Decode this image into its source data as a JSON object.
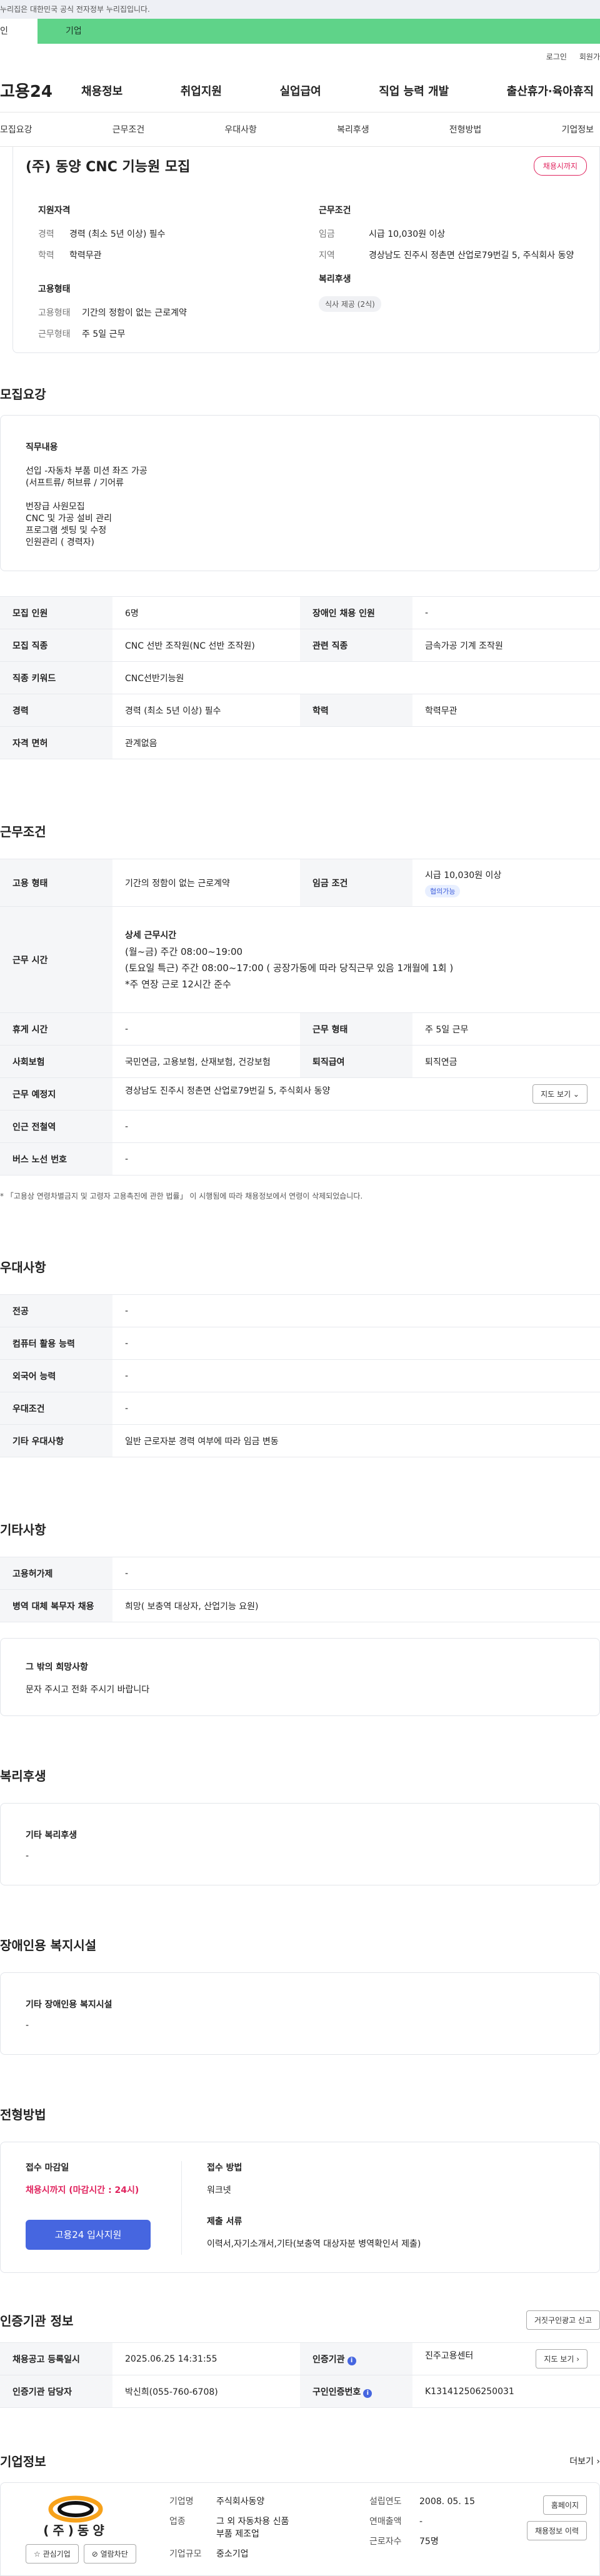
{
  "gov_banner": "누리집은 대한민국 공식 전자정부 누리집입니다.",
  "portal_tabs": {
    "personal": "인",
    "company": "기업"
  },
  "util_links": [
    "로그인",
    "회원가"
  ],
  "gnb": {
    "logo": "고용24",
    "menu": [
      "채용정보",
      "취업지원",
      "실업급여",
      "직업 능력 개발",
      "출산휴가·육아휴직"
    ]
  },
  "subnav": [
    "모집요강",
    "근무조건",
    "우대사항",
    "복리후생",
    "전형방법",
    "기업정보"
  ],
  "summary": {
    "title": "(주) 동양 CNC 기능원 모집",
    "badge": "채용시까지",
    "qualification": {
      "heading": "지원자격",
      "career_k": "경력",
      "career_v": "경력 (최소 5년 이상) 필수",
      "edu_k": "학력",
      "edu_v": "학력무관"
    },
    "conditions": {
      "heading": "근무조건",
      "wage_k": "임금",
      "wage_v": "시급 10,030원 이상",
      "region_k": "지역",
      "region_v": "경상남도 진주시 정촌면 산업로79번길 5, 주식회사 동양"
    },
    "employment": {
      "heading": "고용형태",
      "type_k": "고용형태",
      "type_v": "기간의 정함이 없는 근로계약",
      "form_k": "근무형태",
      "form_v": "주 5일 근무"
    },
    "welfare": {
      "heading": "복리후생",
      "pill": "식사 제공 (2식)"
    }
  },
  "recruit": {
    "section_title": "모집요강",
    "duty_heading": "직무내용",
    "duty_lines": [
      "선입 -자동차 부품 미션 좌즈 가공",
      "(서프트류/ 허브류 / 기어류",
      "",
      "번장급 사원모집",
      "CNC 및 가공 설비 관리",
      "프로그램 셋팅 및 수정",
      "인원관리 ( 경력자)"
    ],
    "rows": [
      [
        "모집 인원",
        "6명",
        "장애인 채용 인원",
        "-"
      ],
      [
        "모집 직종",
        "CNC 선반 조작원(NC 선반 조작원)",
        "관련 직종",
        "금속가공 기계 조작원"
      ],
      [
        "직종 키워드",
        "CNC선반기능원",
        "",
        ""
      ],
      [
        "경력",
        "경력 (최소 5년 이상) 필수",
        "학력",
        "학력무관"
      ],
      [
        "자격 면허",
        "관계없음",
        "",
        ""
      ]
    ]
  },
  "work": {
    "section_title": "근무조건",
    "emp_type_k": "고용 형태",
    "emp_type_v": "기간의 정함이 없는 근로계약",
    "wage_k": "임금 조건",
    "wage_v": "시급 10,030원 이상",
    "wage_pill": "협의가능",
    "hours_k": "근무 시간",
    "hours_heading": "상세 근무시간",
    "hours_lines": [
      "(월~금) 주간 08:00~19:00",
      "(토요일 특근) 주간 08:00~17:00 ( 공장가동에 따라 당직근무 있음 1개월에 1회 )",
      "*주 연장 근로 12시간 준수"
    ],
    "rest_k": "휴게 시간",
    "rest_v": "-",
    "form_k": "근무 형태",
    "form_v": "주 5일 근무",
    "ins_k": "사회보험",
    "ins_v": "국민연금, 고용보험, 산재보험, 건강보험",
    "ret_k": "퇴직급여",
    "ret_v": "퇴직연금",
    "place_k": "근무 예정지",
    "place_v": "경상남도 진주시 정촌면 산업로79번길 5, 주식회사 동양",
    "map_btn": "지도 보기 ⌄",
    "sub_k": "인근 전철역",
    "sub_v": "-",
    "bus_k": "버스 노선 번호",
    "bus_v": "-",
    "note": "* 「고용상 연령차별금지 및 고령자 고용촉진에 관한 법률」 이 시행됨에 따라 채용정보에서 연령이 삭제되었습니다."
  },
  "pref": {
    "section_title": "우대사항",
    "rows": [
      [
        "전공",
        "-"
      ],
      [
        "컴퓨터 활용 능력",
        "-"
      ],
      [
        "외국어 능력",
        "-"
      ],
      [
        "우대조건",
        "-"
      ],
      [
        "기타 우대사항",
        "일반 근로자분 경력 여부에 따라 임금 변동"
      ]
    ]
  },
  "etc": {
    "section_title": "기타사항",
    "rows": [
      [
        "고용허가제",
        "-"
      ],
      [
        "병역 대체 복무자 채용",
        "희망( 보충역 대상자, 산업기능 요원)"
      ]
    ],
    "wish_heading": "그 밖의 희망사항",
    "wish_text": "문자 주시고 전화 주시기 바랍니다"
  },
  "welfare": {
    "section_title": "복리후생",
    "heading": "기타 복리후생",
    "value": "-"
  },
  "disability": {
    "section_title": "장애인용 복지시설",
    "heading": "기타 장애인용 복지시설",
    "value": "-"
  },
  "process": {
    "section_title": "전형방법",
    "deadline_k": "접수 마감일",
    "deadline_v": "채용시까지 (마감시간 : 24시)",
    "apply_btn": "고용24 입사지원",
    "method_k": "접수 방법",
    "method_v": "워크넷",
    "docs_k": "제출 서류",
    "docs_v": "이력서,자기소개서,기타(보충역 대상자분 병역확인서 제출)"
  },
  "cert": {
    "section_title": "인증기관 정보",
    "report_btn": "거짓구인광고 신고",
    "reg_k": "채용공고 등록일시",
    "reg_v": "2025.06.25 14:31:55",
    "org_k": "인증기관",
    "org_v": "진주고용센터",
    "map_btn": "지도 보기 ›",
    "mgr_k": "인증기관 담당자",
    "mgr_v": "박신희(055-760-6708)",
    "no_k": "구인인증번호",
    "no_v": "K131412506250031"
  },
  "company": {
    "section_title": "기업정보",
    "more": "더보기 ›",
    "logo_text": "(주)동양",
    "fav_btn": "☆ 관심기업",
    "block_btn": "⊘ 열람차단",
    "name_k": "기업명",
    "name_v": "주식회사동양",
    "biz_k": "업종",
    "biz_v": "그 외 자동차용 신품 부품 제조업",
    "size_k": "기업규모",
    "size_v": "중소기업",
    "est_k": "설립연도",
    "est_v": "2008. 05. 15",
    "sales_k": "연매출액",
    "sales_v": "-",
    "emp_k": "근로자수",
    "emp_v": "75명",
    "home_btn": "홈페이지",
    "history_btn": "채용정보 이력"
  }
}
